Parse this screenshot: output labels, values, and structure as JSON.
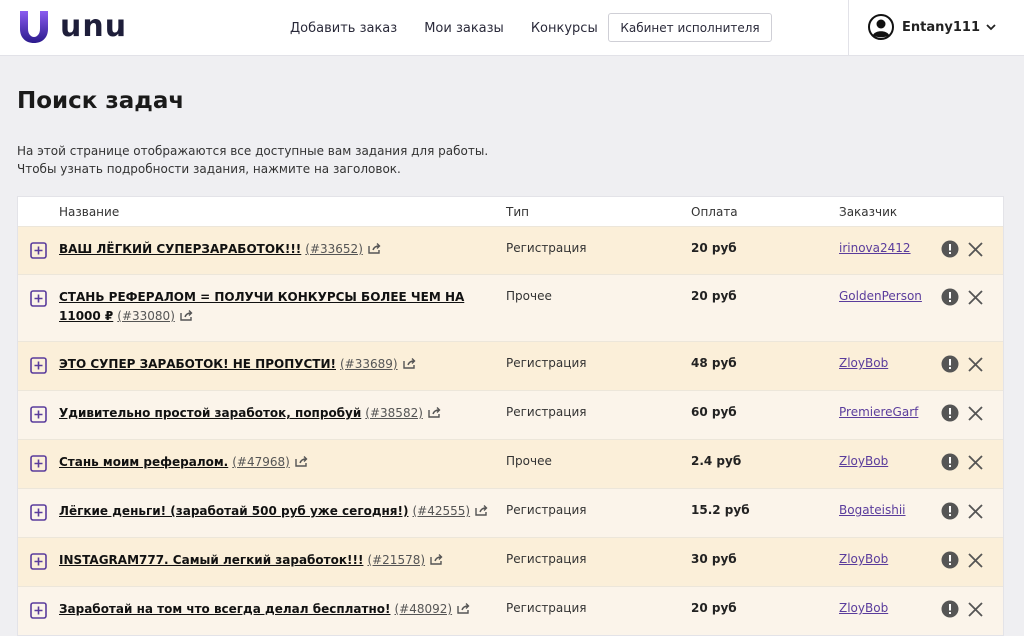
{
  "header": {
    "logo_text": "unu",
    "nav": [
      "Добавить заказ",
      "Мои заказы",
      "Конкурсы"
    ],
    "cabinet_button": "Кабинет исполнителя",
    "username": "Entany111"
  },
  "page": {
    "title": "Поиск задач",
    "desc_line1": "На этой странице отображаются все доступные вам задания для работы.",
    "desc_line2": "Чтобы узнать подробности задания, нажмите на заголовок."
  },
  "table": {
    "columns": [
      "Название",
      "Тип",
      "Оплата",
      "Заказчик"
    ],
    "rows": [
      {
        "title": "ВАШ ЛЁГКИЙ СУПЕРЗАРАБОТОК!!!",
        "id": "(#33652)",
        "type": "Регистрация",
        "pay": "20 руб",
        "client": "irinova2412"
      },
      {
        "title": "СТАНЬ РЕФЕРАЛОМ = ПОЛУЧИ КОНКУРСЫ БОЛЕЕ ЧЕМ НА 11000 ₽",
        "id": "(#33080)",
        "type": "Прочее",
        "pay": "20 руб",
        "client": "GoldenPerson"
      },
      {
        "title": "ЭТО СУПЕР ЗАРАБОТОК! НЕ ПРОПУСТИ!",
        "id": "(#33689)",
        "type": "Регистрация",
        "pay": "48 руб",
        "client": "ZloyBob"
      },
      {
        "title": "Удивительно простой заработок, попробуй",
        "id": "(#38582)",
        "type": "Регистрация",
        "pay": "60 руб",
        "client": "PremiereGarf"
      },
      {
        "title": "Стань моим рефералом.",
        "id": "(#47968)",
        "type": "Прочее",
        "pay": "2.4 руб",
        "client": "ZloyBob"
      },
      {
        "title": "Лёгкие деньги! (заработай 500 руб уже сегодня!)",
        "id": "(#42555)",
        "type": "Регистрация",
        "pay": "15.2 руб",
        "client": "Bogateishii"
      },
      {
        "title": "INSTAGRAM777. Самый легкий заработок!!!",
        "id": "(#21578)",
        "type": "Регистрация",
        "pay": "30 руб",
        "client": "ZloyBob"
      },
      {
        "title": "Заработай на том что всегда делал бесплатно!",
        "id": "(#48092)",
        "type": "Регистрация",
        "pay": "20 руб",
        "client": "ZloyBob"
      }
    ]
  },
  "colors": {
    "accent": "#5a3c9c",
    "row_odd": "#fbefd9",
    "row_even": "#fbf4ea"
  }
}
